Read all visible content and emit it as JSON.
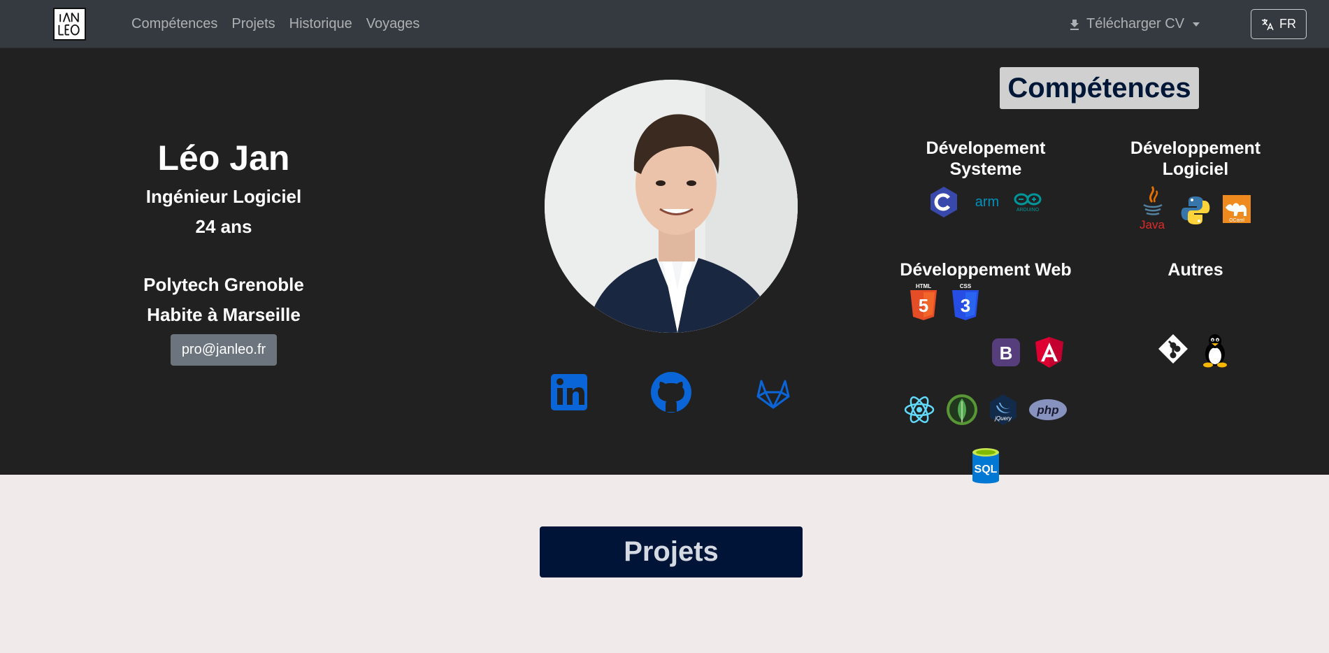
{
  "navbar": {
    "logo_alt": "JAN LEO",
    "links": [
      "Compétences",
      "Projets",
      "Historique",
      "Voyages"
    ],
    "cv_label": "Télécharger CV",
    "lang_label": "FR"
  },
  "profile": {
    "name": "Léo Jan",
    "job": "Ingénieur Logiciel",
    "age": "24 ans",
    "school": "Polytech Grenoble",
    "city": "Habite à Marseille",
    "email": "pro@janleo.fr"
  },
  "social": [
    "linkedin-icon",
    "github-icon",
    "gitlab-icon"
  ],
  "competences": {
    "title": "Compétences",
    "categories": {
      "systeme": "Dévelopement Systeme",
      "logiciel": "Développement Logiciel",
      "web": "Développement Web",
      "autres": "Autres"
    },
    "icons": {
      "systeme": [
        "c-icon",
        "arm-icon",
        "arduino-icon"
      ],
      "logiciel": [
        "java-icon",
        "python-icon",
        "ocaml-icon"
      ],
      "web": [
        "html5-icon",
        "css3-icon",
        "bootstrap-icon",
        "angular-icon",
        "react-icon",
        "mongodb-icon",
        "jquery-icon",
        "php-icon",
        "sql-icon"
      ],
      "autres": [
        "git-icon",
        "linux-icon"
      ]
    },
    "icon_labels": {
      "arm": "arm",
      "arduino": "ARDUINO",
      "java": "Java",
      "ocaml": "OCaml",
      "html": "HTML",
      "css": "CSS",
      "bootstrap": "B",
      "jquery": "jQuery",
      "php": "php",
      "sql": "SQL"
    }
  },
  "projets": {
    "title": "Projets"
  },
  "colors": {
    "navbar": "#343a40",
    "hero": "#212121",
    "page": "#f0eaeb",
    "social_blue": "#0a66d8",
    "projets_bg": "#001437"
  }
}
